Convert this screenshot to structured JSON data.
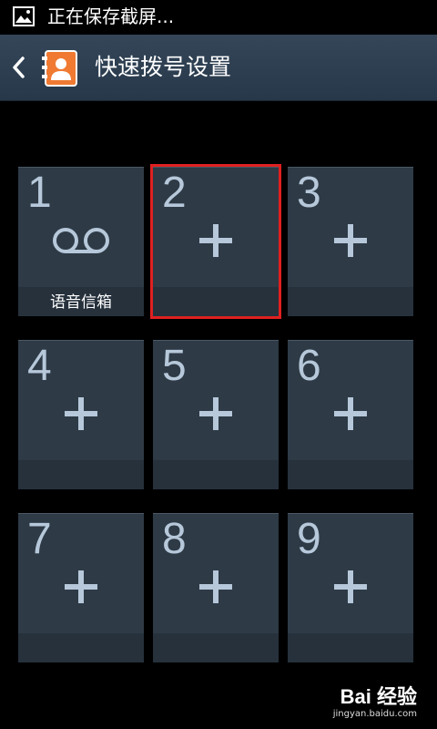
{
  "status_bar": {
    "text": "正在保存截屏...",
    "icon": "image-icon"
  },
  "title_bar": {
    "title": "快速拨号设置",
    "back_icon": "chevron-left-icon",
    "app_icon": "contact-book-icon"
  },
  "tiles": [
    {
      "number": "1",
      "label": "语音信箱",
      "icon": "voicemail-icon"
    },
    {
      "number": "2",
      "label": "",
      "icon": "plus-icon",
      "selected": true
    },
    {
      "number": "3",
      "label": "",
      "icon": "plus-icon"
    },
    {
      "number": "4",
      "label": "",
      "icon": "plus-icon"
    },
    {
      "number": "5",
      "label": "",
      "icon": "plus-icon"
    },
    {
      "number": "6",
      "label": "",
      "icon": "plus-icon"
    },
    {
      "number": "7",
      "label": "",
      "icon": "plus-icon"
    },
    {
      "number": "8",
      "label": "",
      "icon": "plus-icon"
    },
    {
      "number": "9",
      "label": "",
      "icon": "plus-icon"
    }
  ],
  "watermark": {
    "logo": "Bai 经验",
    "url": "jingyan.baidu.com"
  },
  "colors": {
    "background": "#000000",
    "title_bar": "#2e4052",
    "tile": "#2e3a46",
    "tile_number": "#b6c8da",
    "selected_outline": "#e02020"
  }
}
